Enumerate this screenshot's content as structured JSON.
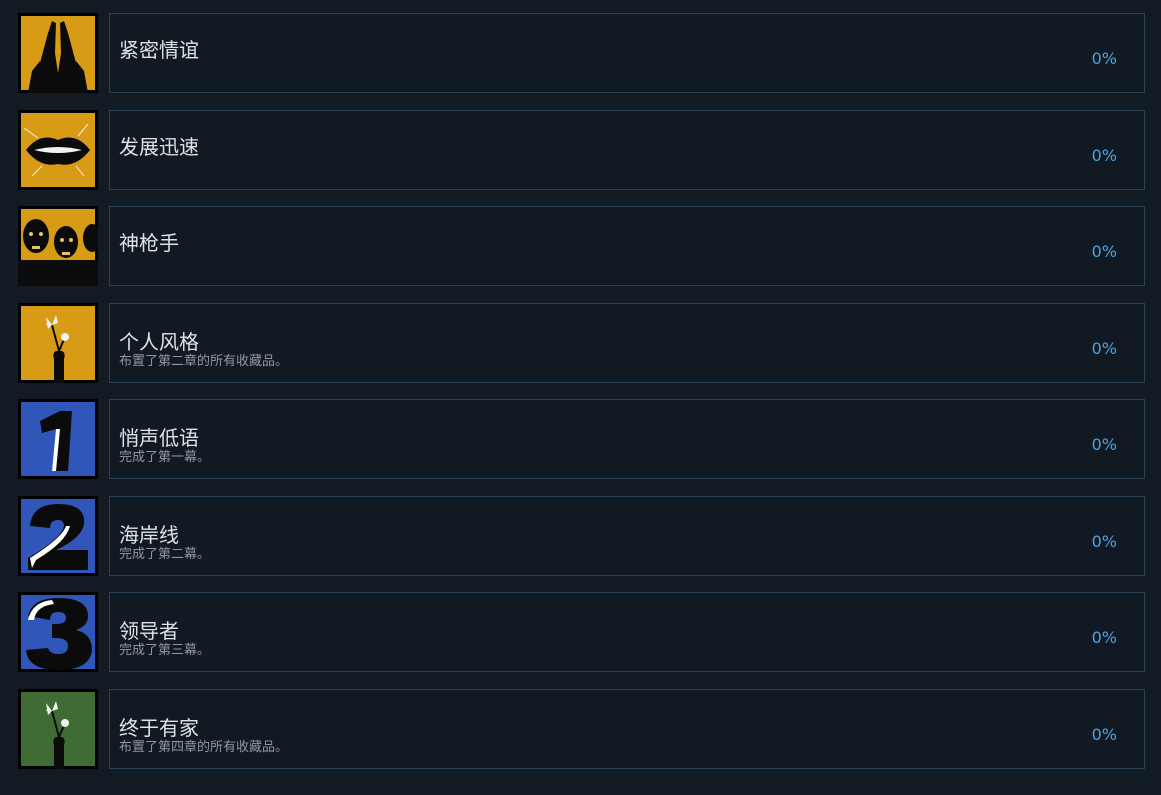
{
  "achievements": [
    {
      "title": "紧密情谊",
      "description": "",
      "percent": "0%",
      "icon": "praying-hands-icon",
      "icon_bg": "#d89b16"
    },
    {
      "title": "发展迅速",
      "description": "",
      "percent": "0%",
      "icon": "lips-icon",
      "icon_bg": "#d89b16"
    },
    {
      "title": "神枪手",
      "description": "",
      "percent": "0%",
      "icon": "zombies-icon",
      "icon_bg": "#d89b16"
    },
    {
      "title": "个人风格",
      "description": "布置了第二章的所有收藏品。",
      "percent": "0%",
      "icon": "flower-vase-icon",
      "icon_bg": "#d89b16"
    },
    {
      "title": "悄声低语",
      "description": "完成了第一幕。",
      "percent": "0%",
      "icon": "number-one-icon",
      "icon_bg": "#2f56b8"
    },
    {
      "title": "海岸线",
      "description": "完成了第二幕。",
      "percent": "0%",
      "icon": "number-two-icon",
      "icon_bg": "#2f56b8"
    },
    {
      "title": "领导者",
      "description": "完成了第三幕。",
      "percent": "0%",
      "icon": "number-three-icon",
      "icon_bg": "#2f56b8"
    },
    {
      "title": "终于有家",
      "description": "布置了第四章的所有收藏品。",
      "percent": "0%",
      "icon": "flower-vase-icon",
      "icon_bg": "#3f6b35"
    }
  ]
}
